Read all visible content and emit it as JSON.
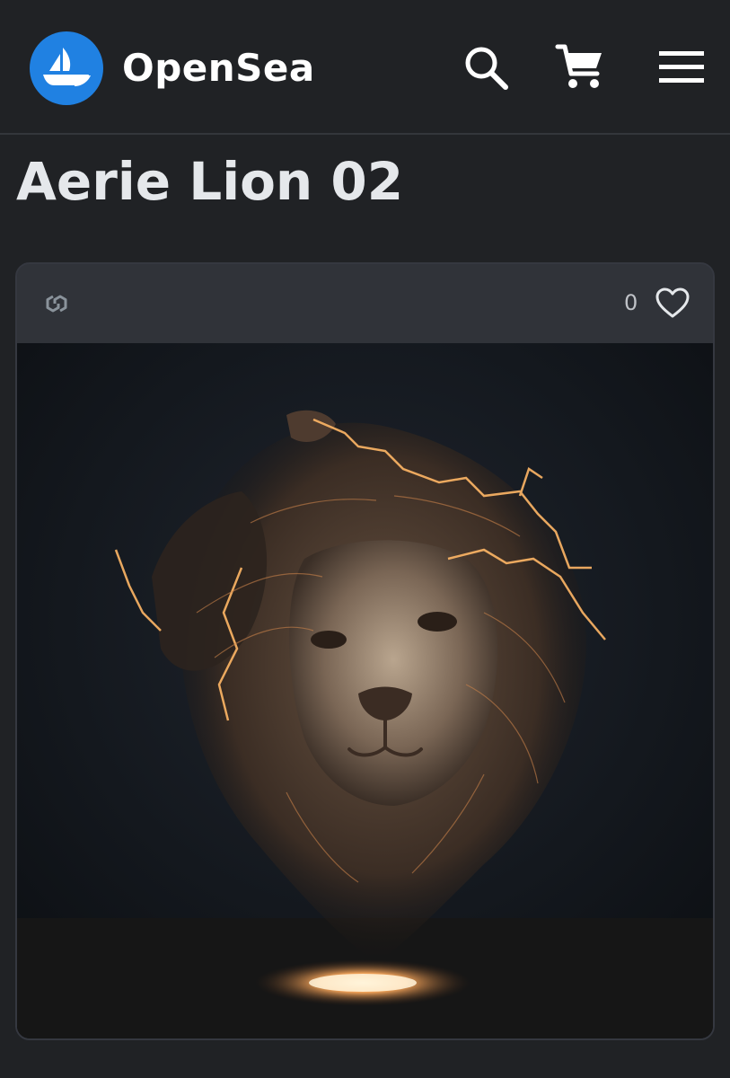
{
  "header": {
    "brand": "OpenSea",
    "logo_icon": "opensea-ship-logo",
    "actions": [
      {
        "name": "search",
        "icon": "search-icon"
      },
      {
        "name": "cart",
        "icon": "cart-icon"
      },
      {
        "name": "menu",
        "icon": "hamburger-menu-icon"
      }
    ]
  },
  "item": {
    "title": "Aerie Lion 02",
    "chain_icon": "polygon-chain-icon",
    "favorites": "0",
    "favorite_icon": "heart-icon",
    "image": "ai-lion-head-with-lightning"
  },
  "colors": {
    "background": "#202225",
    "brand_blue": "#2081e2",
    "card_bar": "#303339",
    "text": "#e5e8eb"
  }
}
